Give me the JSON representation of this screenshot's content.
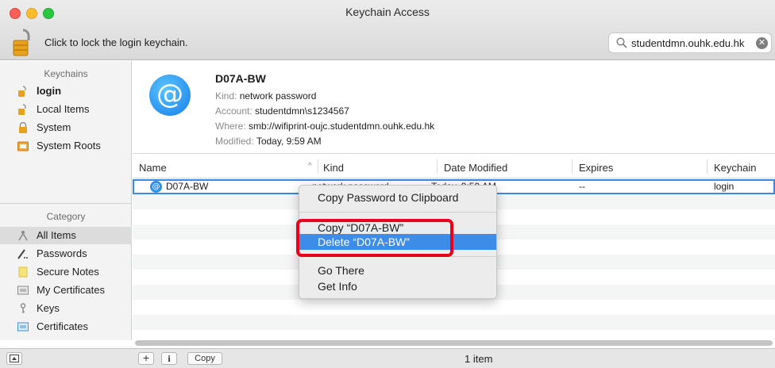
{
  "window": {
    "title": "Keychain Access"
  },
  "toolbar": {
    "lock_label": "Click to lock the login keychain.",
    "search_value": "studentdmn.ouhk.edu.hk"
  },
  "sidebar": {
    "keychains_header": "Keychains",
    "keychains": [
      {
        "label": "login",
        "icon": "open-lock-icon"
      },
      {
        "label": "Local Items",
        "icon": "lock-icon"
      },
      {
        "label": "System",
        "icon": "lock-icon"
      },
      {
        "label": "System Roots",
        "icon": "folder-icon"
      }
    ],
    "category_header": "Category",
    "categories": [
      {
        "label": "All Items",
        "icon": "people-icon"
      },
      {
        "label": "Passwords",
        "icon": "pen-dots-icon"
      },
      {
        "label": "Secure Notes",
        "icon": "note-icon"
      },
      {
        "label": "My Certificates",
        "icon": "certificate-icon"
      },
      {
        "label": "Keys",
        "icon": "key-icon"
      },
      {
        "label": "Certificates",
        "icon": "certificate-icon"
      }
    ]
  },
  "detail": {
    "title": "D07A-BW",
    "kind_key": "Kind:",
    "kind_value": "network password",
    "account_key": "Account:",
    "account_value": "studentdmn\\s1234567",
    "where_key": "Where:",
    "where_value": "smb://wifiprint-oujc.studentdmn.ouhk.edu.hk",
    "modified_key": "Modified:",
    "modified_value": "Today, 9:59 AM"
  },
  "table": {
    "columns": [
      "Name",
      "Kind",
      "Date Modified",
      "Expires",
      "Keychain"
    ],
    "rows": [
      {
        "name": "D07A-BW",
        "kind": "network password",
        "date": "Today, 9:59 AM",
        "expires": "--",
        "keychain": "login"
      }
    ]
  },
  "context_menu": {
    "items": [
      "Copy Password to Clipboard",
      "Copy “D07A-BW”",
      "Delete “D07A-BW”",
      "Go There",
      "Get Info"
    ],
    "highlighted": "Delete “D07A-BW”"
  },
  "bottombar": {
    "add_label": "+",
    "info_label": "i",
    "copy_label": "Copy",
    "status": "1 item"
  },
  "colors": {
    "highlight": "#3d8de8",
    "annotation": "#e8001c",
    "selection_outline": "#3b87e4"
  }
}
